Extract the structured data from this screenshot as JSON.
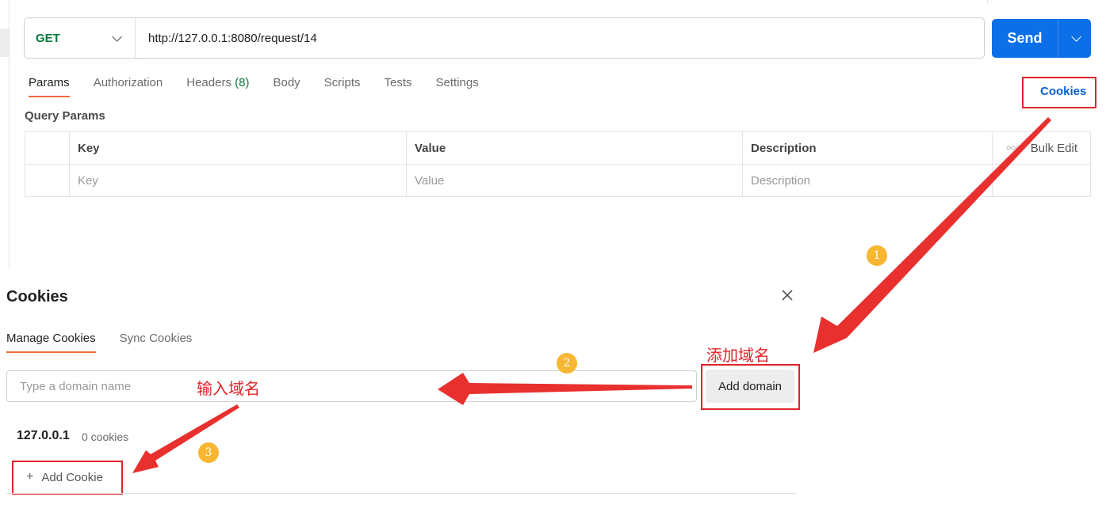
{
  "request": {
    "method": "GET",
    "url": "http://127.0.0.1:8080/request/14",
    "send_label": "Send"
  },
  "tabs": [
    {
      "label": "Params",
      "active": true
    },
    {
      "label": "Authorization"
    },
    {
      "label": "Headers",
      "count": "(8)"
    },
    {
      "label": "Body"
    },
    {
      "label": "Scripts"
    },
    {
      "label": "Tests"
    },
    {
      "label": "Settings"
    }
  ],
  "cookies_link": "Cookies",
  "query_params": {
    "title": "Query Params",
    "headers": [
      "Key",
      "Value",
      "Description"
    ],
    "bulk_edit": "Bulk Edit",
    "placeholders": [
      "Key",
      "Value",
      "Description"
    ]
  },
  "cookie_dialog": {
    "title": "Cookies",
    "tabs": [
      "Manage Cookies",
      "Sync Cookies"
    ],
    "domain_placeholder": "Type a domain name",
    "add_domain_label": "Add domain",
    "domain": "127.0.0.1",
    "cookie_count": "0 cookies",
    "add_cookie_label": "Add Cookie"
  },
  "annotations": {
    "note_add_domain": "添加域名",
    "note_input_domain": "输入域名",
    "badges": [
      "1",
      "2",
      "3"
    ],
    "arrow_color": "#e0242a",
    "badge_color": "#f7b733"
  }
}
